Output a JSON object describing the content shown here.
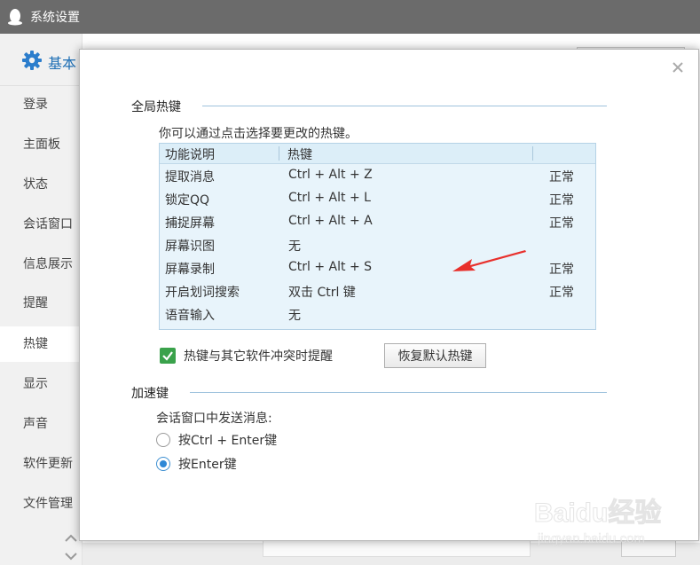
{
  "window": {
    "title": "系统设置"
  },
  "sidebar": {
    "header_label": "基本",
    "items": [
      {
        "label": "登录"
      },
      {
        "label": "主面板"
      },
      {
        "label": "状态"
      },
      {
        "label": "会话窗口"
      },
      {
        "label": "信息展示"
      },
      {
        "label": "提醒"
      },
      {
        "label": "热键",
        "active": true
      },
      {
        "label": "显示"
      },
      {
        "label": "声音"
      },
      {
        "label": "软件更新"
      },
      {
        "label": "文件管理"
      }
    ]
  },
  "dialog": {
    "global_hotkeys": {
      "title": "全局热键",
      "info": "你可以通过点击选择要更改的热键。",
      "columns": [
        "功能说明",
        "热键"
      ],
      "rows": [
        {
          "name": "提取消息",
          "hotkey": "Ctrl + Alt + Z",
          "status": "正常"
        },
        {
          "name": "锁定QQ",
          "hotkey": "Ctrl + Alt + L",
          "status": "正常"
        },
        {
          "name": "捕捉屏幕",
          "hotkey": "Ctrl + Alt + A",
          "status": "正常"
        },
        {
          "name": "屏幕识图",
          "hotkey": "无",
          "status": ""
        },
        {
          "name": "屏幕录制",
          "hotkey": "Ctrl + Alt + S",
          "status": "正常"
        },
        {
          "name": "开启划词搜索",
          "hotkey": "双击 Ctrl 键",
          "status": "正常"
        },
        {
          "name": "语音输入",
          "hotkey": "无",
          "status": ""
        }
      ],
      "conflict_checkbox": {
        "label": "热键与其它软件冲突时提醒",
        "checked": true
      },
      "restore_button": "恢复默认热键"
    },
    "accelerator": {
      "title": "加速键",
      "send_label": "会话窗口中发送消息:",
      "options": [
        {
          "label": "按Ctrl + Enter键",
          "selected": false
        },
        {
          "label": "按Enter键",
          "selected": true
        }
      ]
    }
  },
  "watermark": {
    "logo": "Baidu经验",
    "url": "jingyan.baidu.com"
  },
  "colors": {
    "accent": "#2f88d6",
    "check": "#3aa24b",
    "annotation_arrow": "#e8302c"
  }
}
